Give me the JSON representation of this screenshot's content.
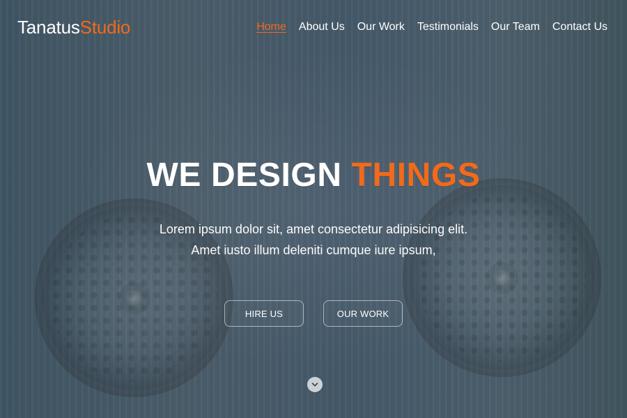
{
  "brand": {
    "part1": "Tanatus",
    "part2": "Studio"
  },
  "nav": {
    "items": [
      {
        "label": "Home",
        "active": true
      },
      {
        "label": "About Us"
      },
      {
        "label": "Our Work"
      },
      {
        "label": "Testimonials"
      },
      {
        "label": "Our Team"
      },
      {
        "label": "Contact Us"
      }
    ]
  },
  "hero": {
    "headline_prefix": "WE DESIGN",
    "headline_accent": "THINGS",
    "lead_line_1": "Lorem ipsum dolor sit, amet consectetur adipisicing elit.",
    "lead_line_2": "Amet iusto illum deleniti cumque iure ipsum,",
    "buttons": {
      "hire_us": "HIRE US",
      "our_work": "OUR WORK"
    },
    "scroll_icon": "chevron-down-icon"
  },
  "colors": {
    "accent": "#f26a1b",
    "text": "#ffffff"
  }
}
